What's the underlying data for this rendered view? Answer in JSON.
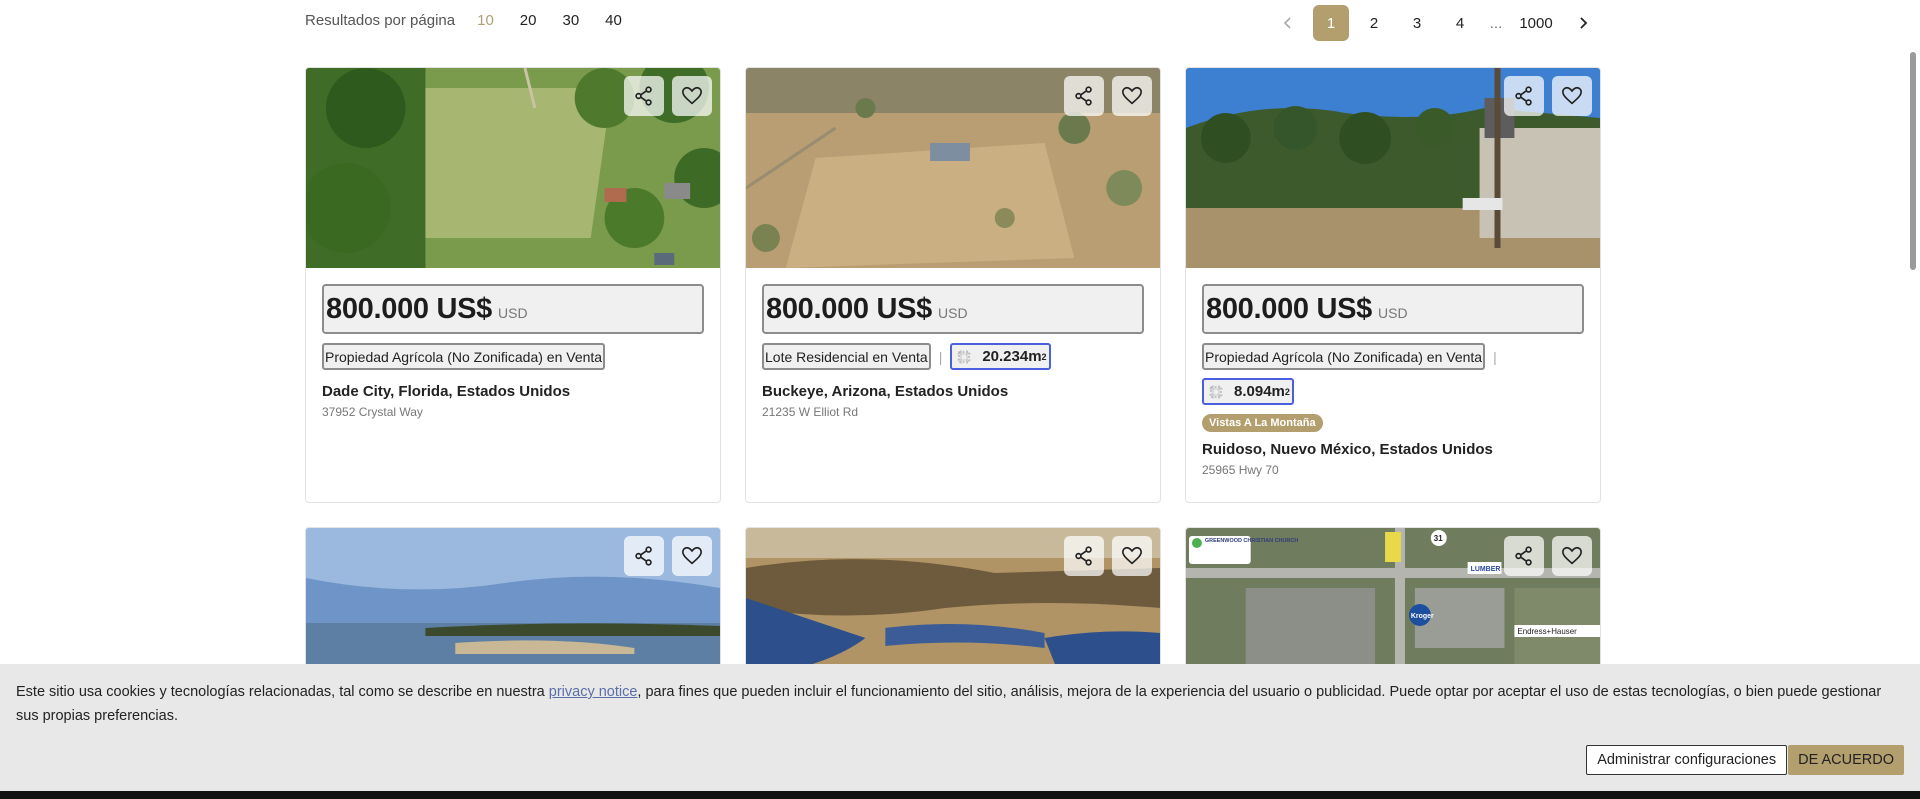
{
  "results_per_page": {
    "label": "Resultados por página",
    "options": [
      "10",
      "20",
      "30",
      "40"
    ],
    "selected": "10"
  },
  "pagination": {
    "pages": [
      "1",
      "2",
      "3",
      "4"
    ],
    "ellipsis": "...",
    "last": "1000",
    "current": "1"
  },
  "listings": [
    {
      "price": "800.000 US$",
      "currency": "USD",
      "type": "Propiedad Agrícola (No Zonificada) en Venta",
      "area": "",
      "badge": "",
      "location": "Dade City, Florida, Estados Unidos",
      "address": "37952 Crystal Way"
    },
    {
      "price": "800.000 US$",
      "currency": "USD",
      "type": "Lote Residencial en Venta",
      "area": "20.234m",
      "area_unit_sup": "2",
      "badge": "",
      "location": "Buckeye, Arizona, Estados Unidos",
      "address": "21235 W Elliot Rd"
    },
    {
      "price": "800.000 US$",
      "currency": "USD",
      "type": "Propiedad Agrícola (No Zonificada) en Venta",
      "area": "8.094m",
      "area_unit_sup": "2",
      "badge": "Vistas A La Montaña",
      "location": "Ruidoso, Nuevo México, Estados Unidos",
      "address": "25965 Hwy 70"
    }
  ],
  "cookie_banner": {
    "text_before_link": "Este sitio usa cookies y tecnologías relacionadas, tal como se describe en nuestra ",
    "link": "privacy notice",
    "text_after_link": ", para fines que pueden incluir el funcionamiento del sitio, análisis, mejora de la experiencia del usuario o publicidad. Puede optar por aceptar el uso de estas tecnologías, o bien puede gestionar sus propias preferencias.",
    "manage_button": "Administrar configuraciones",
    "accept_button": "DE ACUERDO"
  },
  "map_image_text": {
    "church": "GREENWOOD CHRISTIAN CHURCH",
    "route": "31",
    "lumber": "LUMBER",
    "store": "Kroger",
    "company": "Endress+Hauser"
  },
  "colors": {
    "accent": "#b39e6e",
    "area_border": "#4b5fe0"
  },
  "icons": [
    "chevron-left-icon",
    "chevron-right-icon",
    "share-icon",
    "heart-icon",
    "area-icon"
  ]
}
